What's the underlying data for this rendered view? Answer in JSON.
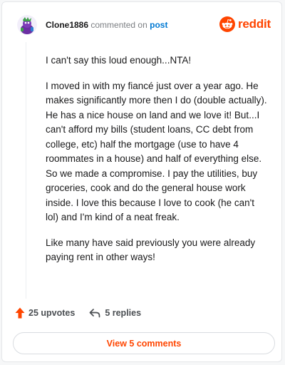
{
  "header": {
    "username": "Clone1886",
    "commented_on_text": "commented on",
    "post_link": "post",
    "logo_word": "reddit",
    "logo_icon": "reddit-snoo-icon",
    "brand_color": "#ff4500"
  },
  "comment": {
    "paragraphs": [
      "I can't say this loud enough...NTA!",
      "I moved in with my fiancé just over a year ago. He makes significantly more then I do (double actually). He has a nice house on land and we love it! But...I can't afford my bills (student loans, CC debt from college, etc) half the mortgage (use to have 4 roommates in a house) and half of everything else. So we made a compromise. I pay the utilities, buy groceries, cook and do the general house work inside. I love this because I love to cook (he can't lol) and I'm kind of a neat freak.",
      "Like many have said previously you were already paying rent in other ways!"
    ]
  },
  "actions": {
    "upvotes": "25 upvotes",
    "upvote_icon": "upvote-arrow-icon",
    "replies": "5 replies",
    "reply_icon": "reply-arrow-icon"
  },
  "view_button": {
    "label": "View 5 comments"
  }
}
